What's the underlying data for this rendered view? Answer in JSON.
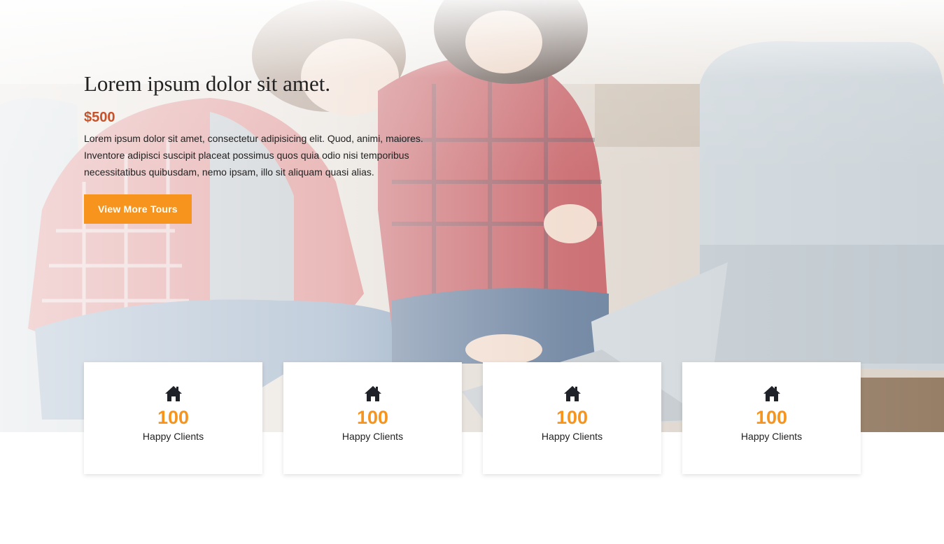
{
  "hero": {
    "title": "Lorem ipsum dolor sit amet.",
    "price": "$500",
    "description": "Lorem ipsum dolor sit amet, consectetur adipisicing elit. Quod, animi, maiores. Inventore adipisci suscipit placeat possimus quos quia odio nisi temporibus necessitatibus quibusdam, nemo ipsam, illo sit aliquam quasi alias.",
    "button_label": "View More Tours"
  },
  "stats": [
    {
      "icon": "home-icon",
      "value": "100",
      "label": "Happy Clients"
    },
    {
      "icon": "home-icon",
      "value": "100",
      "label": "Happy Clients"
    },
    {
      "icon": "home-icon",
      "value": "100",
      "label": "Happy Clients"
    },
    {
      "icon": "home-icon",
      "value": "100",
      "label": "Happy Clients"
    }
  ],
  "colors": {
    "accent": "#f7941d",
    "price": "#c8522a",
    "text": "#222222"
  }
}
